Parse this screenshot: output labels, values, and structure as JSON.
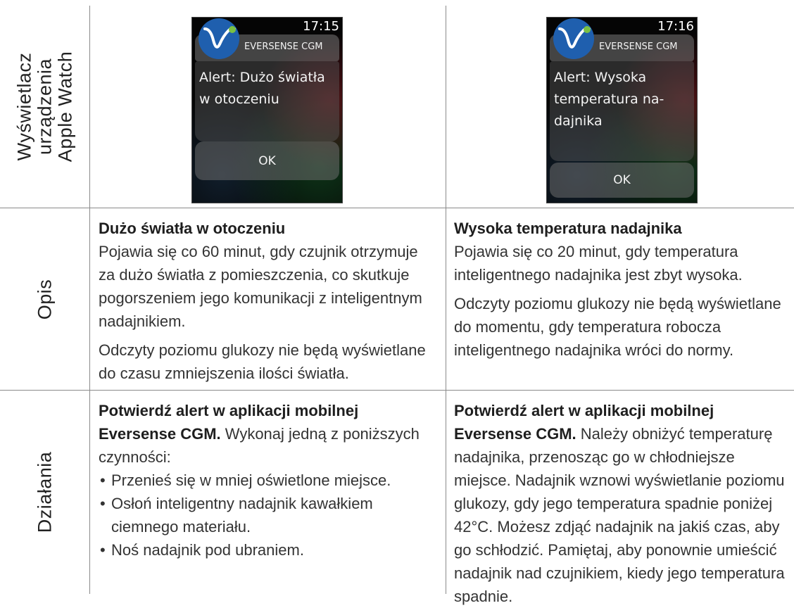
{
  "rows": {
    "display_label": "Wyświetlacz\nurządzenia\nApple Watch",
    "description_label": "Opis",
    "actions_label": "Działania"
  },
  "watch_left": {
    "time": "17:15",
    "app_name": "EVERSENSE CGM",
    "alert_text": "Alert:  Dużo światła w otoczeniu",
    "ok_label": "OK"
  },
  "watch_right": {
    "time": "17:16",
    "app_name": "EVERSENSE CGM",
    "alert_text": "Alert:  Wysoka temperatura na-dajnika",
    "ok_label": "OK"
  },
  "description_left": {
    "title": "Dużo światła w otoczeniu",
    "paragraph1": "Pojawia się co 60 minut, gdy czujnik otrzymuje za dużo światła z pomieszczenia, co skutkuje pogorszeniem jego komunikacji z inteligentnym nadajnikiem.",
    "paragraph2": "Odczyty poziomu glukozy nie będą wyświetlane do czasu zmniejszenia ilości światła."
  },
  "description_right": {
    "title": "Wysoka temperatura nadajnika",
    "paragraph1": "Pojawia się co 20 minut, gdy temperatura inteligentnego nadajnika jest zbyt wysoka.",
    "paragraph2": "Odczyty poziomu glukozy nie będą wyświetlane do momentu, gdy temperatura robocza inteligentnego nadajnika wróci do normy."
  },
  "actions_left": {
    "lead_bold": "Potwierdź alert w aplikacji mobilnej Eversense CGM.",
    "lead_rest": " Wykonaj jedną z poniższych czynności:",
    "bullets": [
      "Przenieś się w mniej oświetlone miejsce.",
      "Osłoń inteligentny nadajnik kawałkiem ciemnego materiału.",
      "Noś nadajnik pod ubraniem."
    ]
  },
  "actions_right": {
    "lead_bold": "Potwierdź alert w aplikacji mobilnej Eversense CGM.",
    "lead_rest": " Należy obniżyć temperaturę nadajnika, przenosząc go w chłodniejsze miejsce. Nadajnik wznowi wyświetlanie poziomu glukozy, gdy jego temperatura spadnie poniżej 42°C. Możesz zdjąć nadajnik na jakiś czas, aby go schłodzić. Pamiętaj, aby ponownie umieścić nadajnik nad czujnikiem, kiedy jego temperatura spadnie."
  },
  "colors": {
    "logo_blue": "#1f5fae",
    "logo_green": "#7ac143",
    "rule_gray": "#8a8a8a"
  }
}
